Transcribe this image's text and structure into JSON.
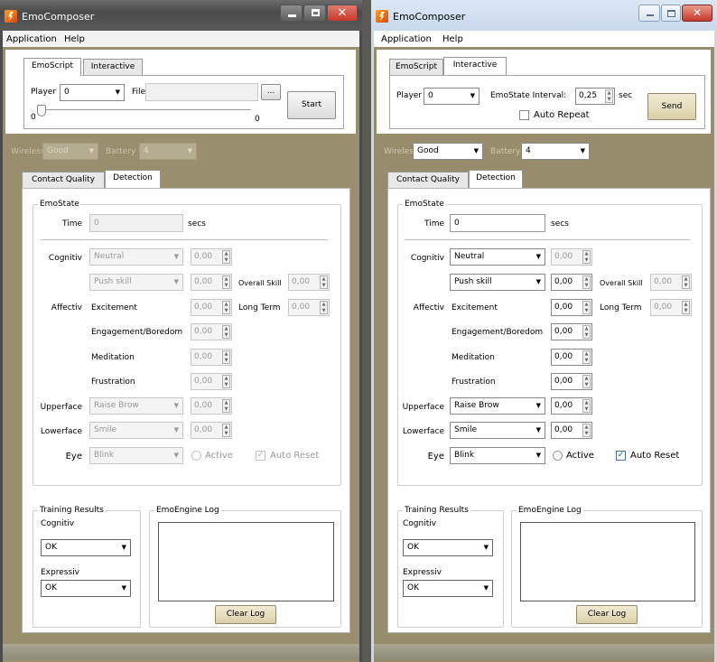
{
  "left": {
    "title": "EmoComposer",
    "menu": [
      "Application",
      "Help"
    ],
    "tabs": [
      "EmoScript",
      "Interactive"
    ],
    "player_label": "Player",
    "player_value": "0",
    "file_label": "File",
    "file_value": "",
    "browse_label": "...",
    "slider_min": "0",
    "slider_max": "0",
    "slider_value": 0,
    "start_label": "Start",
    "wireless_label": "Wireless",
    "wireless_value": "Good",
    "battery_label": "Battery",
    "battery_value": "4",
    "bottom_tabs": [
      "Contact Quality",
      "Detection"
    ],
    "emostate_title": "EmoState",
    "time_label": "Time",
    "time_value": "0",
    "time_unit": "secs",
    "cognitiv_label": "Cognitiv",
    "cognitiv_action": "Neutral",
    "cognitiv_value": "0,00",
    "push_action": "Push skill",
    "push_value": "0,00",
    "overall_skill_label": "Overall Skill",
    "overall_skill_value": "0,00",
    "affectiv_label": "Affectiv",
    "excitement_label": "Excitement",
    "excitement_value": "0,00",
    "long_term_label": "Long Term",
    "long_term_value": "0,00",
    "engagement_label": "Engagement/Boredom",
    "engagement_value": "0,00",
    "meditation_label": "Meditation",
    "meditation_value": "0,00",
    "frustration_label": "Frustration",
    "frustration_value": "0,00",
    "upperface_label": "Upperface",
    "upperface_action": "Raise Brow",
    "upperface_value": "0,00",
    "lowerface_label": "Lowerface",
    "lowerface_action": "Smile",
    "lowerface_value": "0,00",
    "eye_label": "Eye",
    "eye_action": "Blink",
    "active_label": "Active",
    "auto_reset_label": "Auto Reset",
    "auto_reset_checked": true,
    "training_title": "Training Results",
    "training_cognitiv_label": "Cognitiv",
    "training_cognitiv_value": "OK",
    "training_expressiv_label": "Expressiv",
    "training_expressiv_value": "OK",
    "log_title": "EmoEngine Log",
    "clear_log_label": "Clear Log"
  },
  "right": {
    "title": "EmoComposer",
    "menu": [
      "Application",
      "Help"
    ],
    "tabs": [
      "EmoScript",
      "Interactive"
    ],
    "player_label": "Player",
    "player_value": "0",
    "interval_label": "EmoState Interval:",
    "interval_value": "0,25",
    "interval_unit": "sec",
    "auto_repeat_label": "Auto Repeat",
    "send_label": "Send",
    "wireless_label": "Wireless",
    "wireless_value": "Good",
    "battery_label": "Battery",
    "battery_value": "4",
    "bottom_tabs": [
      "Contact Quality",
      "Detection"
    ],
    "emostate_title": "EmoState",
    "time_label": "Time",
    "time_value": "0",
    "time_unit": "secs",
    "cognitiv_label": "Cognitiv",
    "cognitiv_action": "Neutral",
    "cognitiv_value": "0,00",
    "push_action": "Push skill",
    "push_value": "0,00",
    "overall_skill_label": "Overall Skill",
    "overall_skill_value": "0,00",
    "affectiv_label": "Affectiv",
    "excitement_label": "Excitement",
    "excitement_value": "0,00",
    "long_term_label": "Long Term",
    "long_term_value": "0,00",
    "engagement_label": "Engagement/Boredom",
    "engagement_value": "0,00",
    "meditation_label": "Meditation",
    "meditation_value": "0,00",
    "frustration_label": "Frustration",
    "frustration_value": "0,00",
    "upperface_label": "Upperface",
    "upperface_action": "Raise Brow",
    "upperface_value": "0,00",
    "lowerface_label": "Lowerface",
    "lowerface_action": "Smile",
    "lowerface_value": "0,00",
    "eye_label": "Eye",
    "eye_action": "Blink",
    "active_label": "Active",
    "auto_reset_label": "Auto Reset",
    "auto_reset_checked": true,
    "training_title": "Training Results",
    "training_cognitiv_label": "Cognitiv",
    "training_cognitiv_value": "OK",
    "training_expressiv_label": "Expressiv",
    "training_expressiv_value": "OK",
    "log_title": "EmoEngine Log",
    "clear_log_label": "Clear Log"
  },
  "icons": {
    "app": "emocomposer-app-icon",
    "minimize": "minimize-icon",
    "maximize": "maximize-icon",
    "close": "close-icon",
    "dropdown": "chevron-down-icon",
    "spin": "spin-up-down-icon",
    "check": "checkmark-icon"
  },
  "colors": {
    "frame_olive": "#998e6d",
    "close_red": "#c8372b",
    "titlebar_dark": "#5a5a5a",
    "titlebar_light": "#d5e3f2",
    "disabled_text": "#9a9a9a"
  }
}
